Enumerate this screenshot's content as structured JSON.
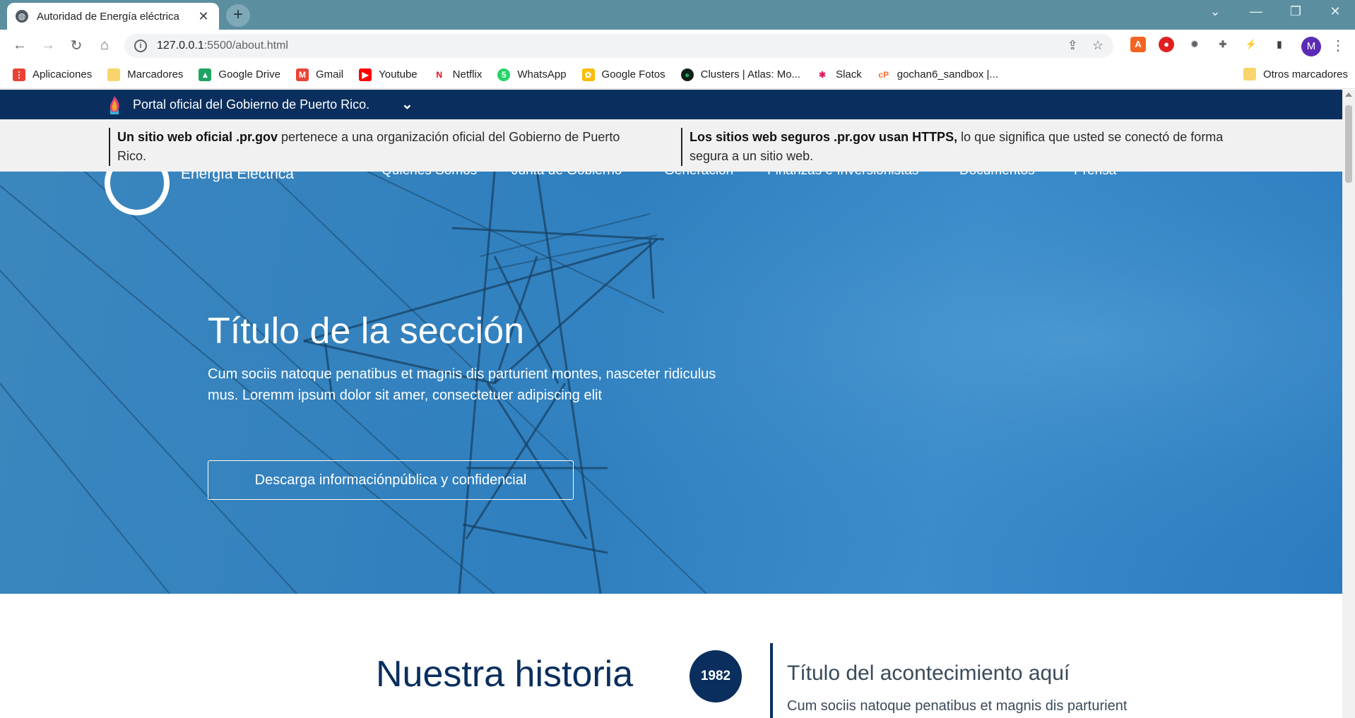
{
  "browser": {
    "tab_title": "Autoridad de Energía eléctrica",
    "url_host": "127.0.0.1",
    "url_rest": ":5500/about.html",
    "avatar_letter": "M",
    "bookmarks": [
      {
        "label": "Aplicaciones",
        "icon": "apps-grid-icon",
        "color": "#ea4335"
      },
      {
        "label": "Marcadores",
        "icon": "folder-icon",
        "color": "#f7d56b"
      },
      {
        "label": "Google Drive",
        "icon": "google-drive-icon",
        "color": "#1fa463"
      },
      {
        "label": "Gmail",
        "icon": "gmail-icon",
        "color": "#ea4335"
      },
      {
        "label": "Youtube",
        "icon": "youtube-icon",
        "color": "#ff0000"
      },
      {
        "label": "Netflix",
        "icon": "netflix-icon",
        "color": "#e50914"
      },
      {
        "label": "WhatsApp",
        "icon": "whatsapp-icon",
        "color": "#25d366"
      },
      {
        "label": "Google Fotos",
        "icon": "google-photos-icon",
        "color": "#fbbc04"
      },
      {
        "label": "Clusters | Atlas: Mo...",
        "icon": "mongodb-icon",
        "color": "#13aa52"
      },
      {
        "label": "Slack",
        "icon": "slack-icon",
        "color": "#e01e5a"
      },
      {
        "label": "gochan6_sandbox |...",
        "icon": "cpanel-icon",
        "color": "#ff6c2c"
      }
    ],
    "other_bookmarks": "Otros marcadores"
  },
  "gov": {
    "portal_text": "Portal oficial del Gobierno de Puerto Rico.",
    "notice_left_bold": "Un sitio web oficial .pr.gov",
    "notice_left_rest": " pertenece a una organización oficial del Gobierno de Puerto Rico.",
    "notice_right_bold": "Los sitios web seguros .pr.gov usan HTTPS,",
    "notice_right_rest": " lo que significa que usted se conectó de forma segura a un sitio web."
  },
  "site": {
    "brand": "Energía Eléctrica",
    "nav": [
      "Quiénes Somos",
      "Junta de Gobierno",
      "Generación",
      "Finanzas e Inversionistas",
      "Documentos",
      "Prensa"
    ]
  },
  "hero": {
    "title": "Título de la sección",
    "body": "Cum sociis natoque penatibus et magnis dis parturient montes, nasceter ridiculus mus. Loremm ipsum dolor sit amer, consectetuer adipiscing elit",
    "cta": "Descarga informaciónpública y confidencial"
  },
  "history": {
    "heading": "Nuestra historia",
    "year": "1982",
    "event_title": "Título del acontecimiento aquí",
    "event_desc": "Cum sociis natoque penatibus et magnis dis parturient"
  }
}
